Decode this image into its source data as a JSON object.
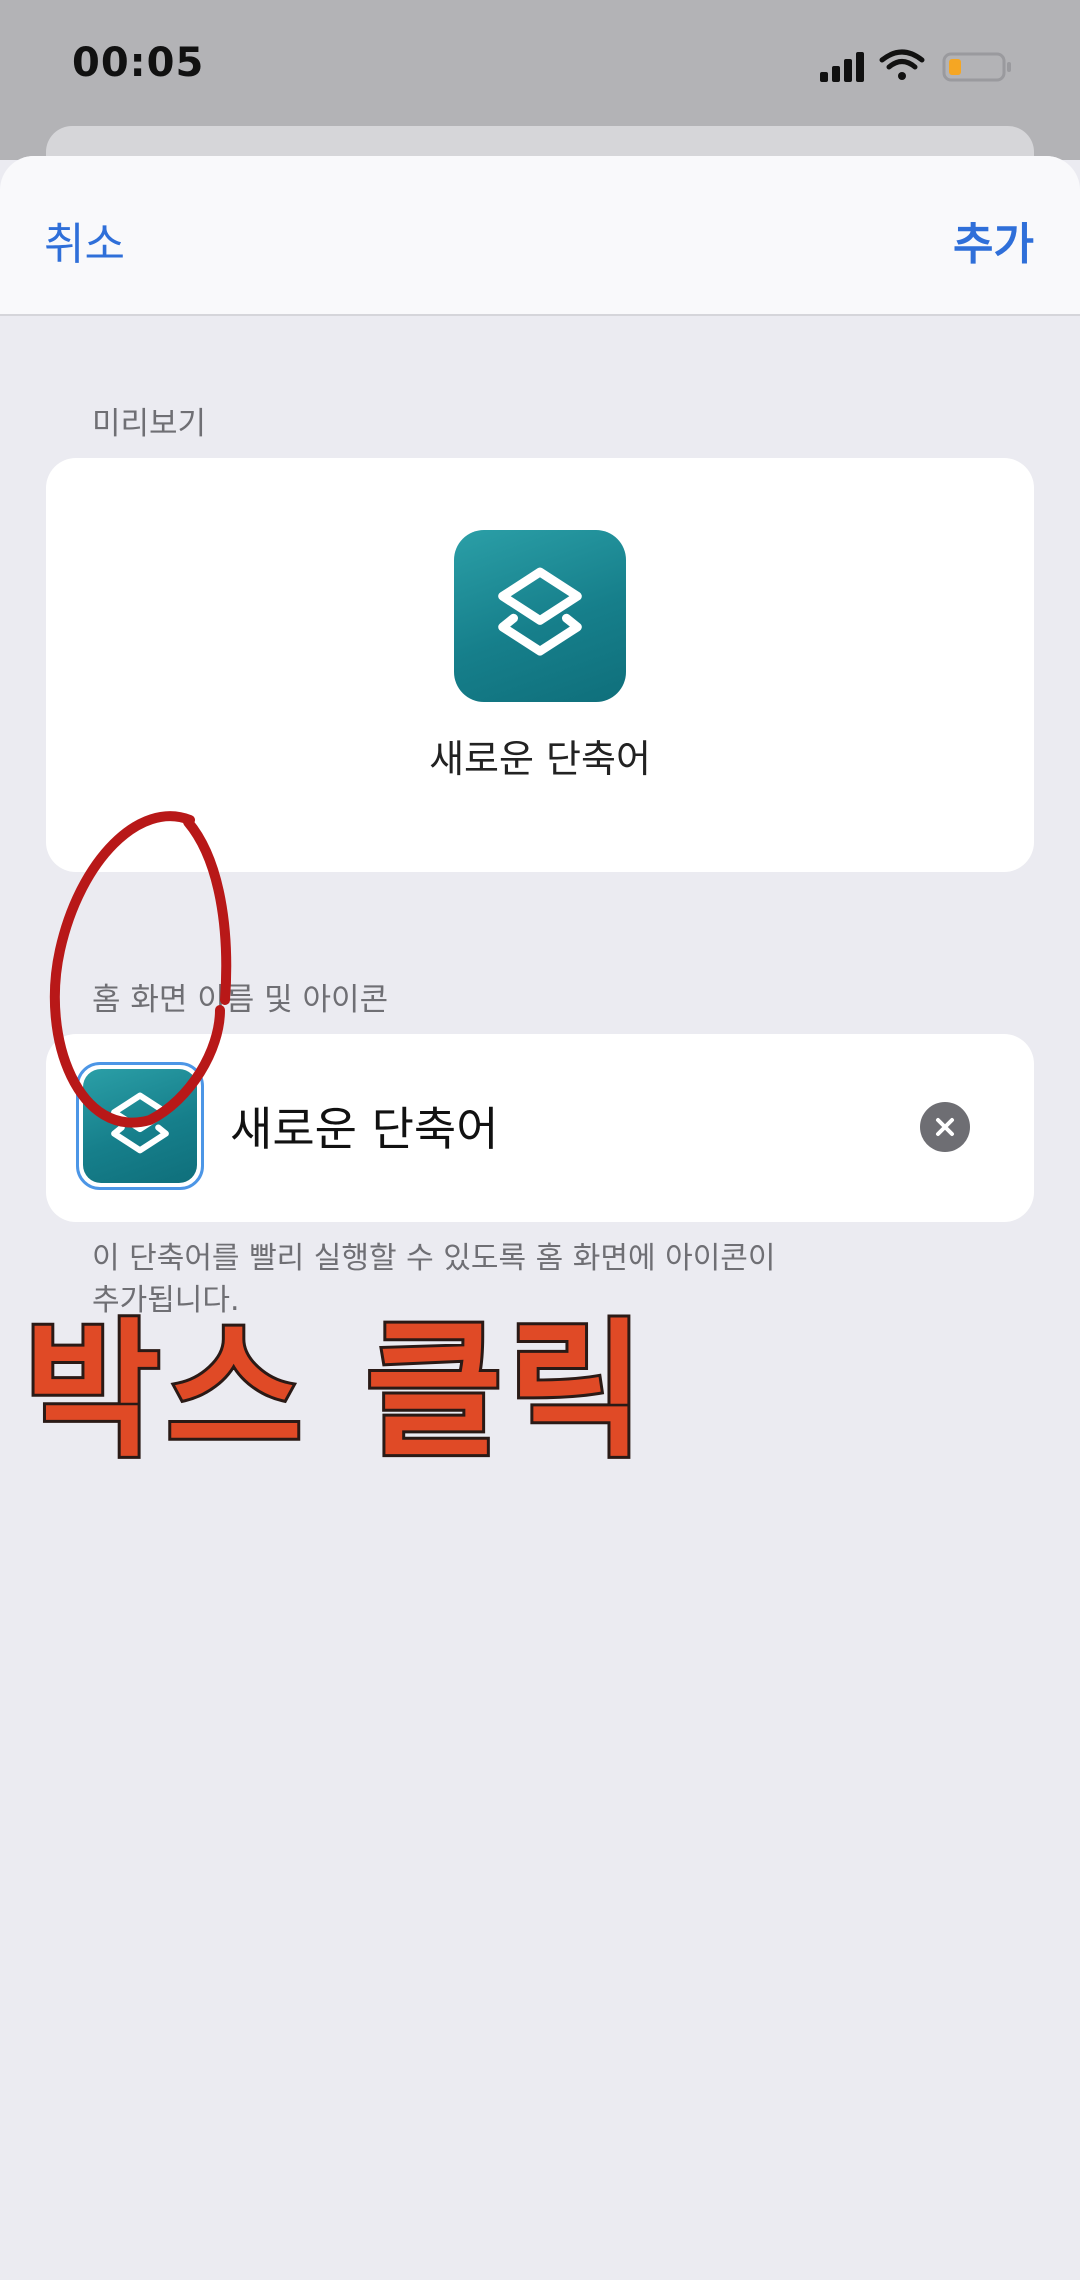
{
  "status_bar": {
    "time": "00:05",
    "icons": [
      "signal-icon",
      "wifi-icon",
      "battery-icon"
    ],
    "battery_color": "#f5a623"
  },
  "nav": {
    "cancel_label": "취소",
    "add_label": "추가",
    "accent_color": "#2f6fd9"
  },
  "preview": {
    "section_label": "미리보기",
    "shortcut_name": "새로운 단축어",
    "icon": "shortcuts-stack-icon",
    "icon_color": "#167f8b"
  },
  "home_screen": {
    "section_label": "홈 화면 이름 및 아이콘",
    "name_value": "새로운 단축어",
    "icon": "shortcuts-stack-icon",
    "clear_icon": "clear-circle-icon",
    "footnote": "이 단축어를 빨리 실행할 수 있도록 홈 화면에 아이콘이 추가됩니다."
  },
  "annotation": {
    "text": "박스 클릭",
    "circle_color": "#b81818",
    "text_color": "#e04a26"
  }
}
